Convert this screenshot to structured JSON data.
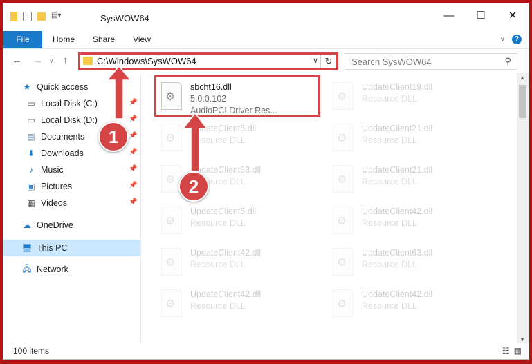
{
  "window": {
    "title": "SysWOW64",
    "controls": {
      "minimize": "—",
      "maximize": "☐",
      "close": "✕"
    }
  },
  "ribbon": {
    "tabs": [
      "File",
      "Home",
      "Share",
      "View"
    ],
    "help_label": "?"
  },
  "nav": {
    "back_label": "←",
    "forward_label": "→",
    "up_label": "↑",
    "address": "C:\\Windows\\SysWOW64",
    "dropdown_label": "∨",
    "refresh_label": "↻",
    "search_placeholder": "Search SysWOW64"
  },
  "sidebar": {
    "items": [
      {
        "label": "Quick access",
        "icon": "star-icon",
        "pinned": false
      },
      {
        "label": "Local Disk (C:)",
        "icon": "drive-icon",
        "pinned": true
      },
      {
        "label": "Local Disk (D:)",
        "icon": "drive-icon",
        "pinned": true
      },
      {
        "label": "Documents",
        "icon": "documents-icon",
        "pinned": true
      },
      {
        "label": "Downloads",
        "icon": "download-icon",
        "pinned": true
      },
      {
        "label": "Music",
        "icon": "music-icon",
        "pinned": true
      },
      {
        "label": "Pictures",
        "icon": "pictures-icon",
        "pinned": true
      },
      {
        "label": "Videos",
        "icon": "videos-icon",
        "pinned": true
      },
      {
        "label": "OneDrive",
        "icon": "cloud-icon",
        "pinned": false
      },
      {
        "label": "This PC",
        "icon": "computer-icon",
        "pinned": false,
        "selected": true
      },
      {
        "label": "Network",
        "icon": "network-icon",
        "pinned": false
      }
    ]
  },
  "files": {
    "selected": {
      "name": "sbcht16.dll",
      "version": "5.0.0.102",
      "description": "AudioPCI Driver Res..."
    },
    "ghost_items": [
      {
        "name": "UpdateClient19.dll",
        "type": "Resource DLL"
      },
      {
        "name": "UpdateClient5.dll",
        "type": "Resource DLL"
      },
      {
        "name": "UpdateClient21.dll",
        "type": "Resource DLL"
      },
      {
        "name": "UpdateClient63.dll",
        "type": "Resource DLL"
      },
      {
        "name": "UpdateClient21.dll",
        "type": "Resource DLL"
      },
      {
        "name": "UpdateClient5.dll",
        "type": "Resource DLL"
      },
      {
        "name": "UpdateClient42.dll",
        "type": "Resource DLL"
      },
      {
        "name": "UpdateClient42.dll",
        "type": "Resource DLL"
      },
      {
        "name": "UpdateClient63.dll",
        "type": "Resource DLL"
      },
      {
        "name": "UpdateClient42.dll",
        "type": "Resource DLL"
      },
      {
        "name": "UpdateClient42.dll",
        "type": "Resource DLL"
      }
    ]
  },
  "status": {
    "item_count": "100 items"
  },
  "annotations": {
    "step1": "1",
    "step2": "2",
    "accent_color": "#d64545"
  }
}
